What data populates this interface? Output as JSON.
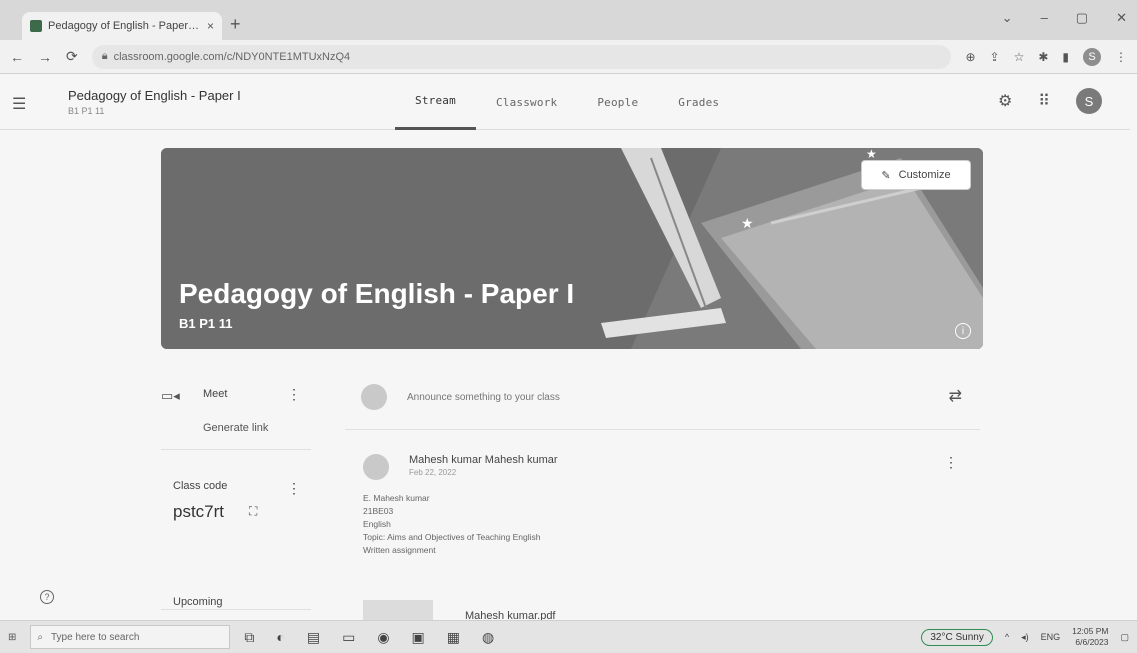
{
  "browser": {
    "tab_title": "Pedagogy of English - Paper I | Cl",
    "tab_close": "×",
    "new_tab": "+",
    "url": "classroom.google.com/c/NDY0NTE1MTUxNzQ4",
    "window_controls": [
      "⌄",
      "–",
      "▢",
      "✕"
    ],
    "profile_initial": "S"
  },
  "classroom_header": {
    "course_name": "Pedagogy of English - Paper I",
    "section": "B1 P1 11",
    "tabs": [
      {
        "label": "Stream"
      },
      {
        "label": "Classwork"
      },
      {
        "label": "People"
      },
      {
        "label": "Grades"
      }
    ],
    "avatar_initial": "S"
  },
  "banner": {
    "title": "Pedagogy of English - Paper I",
    "subtitle": "B1 P1 11",
    "customize_label": "Customize",
    "info_glyph": "i"
  },
  "meet": {
    "label": "Meet",
    "generate_link": "Generate link"
  },
  "class_code": {
    "label": "Class code",
    "value": "pstc7rt"
  },
  "upcoming": {
    "label": "Upcoming"
  },
  "announce": {
    "placeholder": "Announce something to your class"
  },
  "post": {
    "author": "Mahesh kumar Mahesh kumar",
    "date": "Feb 22, 2022",
    "lines": [
      "E. Mahesh kumar",
      "21BE03",
      "English",
      "Topic: Aims and Objectives of Teaching English",
      "Written assignment"
    ],
    "attachment_name": "Mahesh kumar.pdf"
  },
  "help_glyph": "?",
  "taskbar": {
    "search_placeholder": "Type here to search",
    "weather": "32°C  Sunny",
    "language": "ENG",
    "time": "12:05 PM",
    "date": "6/6/2023"
  },
  "icons": {
    "lock": "lock-icon",
    "hamburger": "menu-icon",
    "settings": "gear-icon",
    "apps": "apps-grid-icon",
    "meet": "video-camera-icon",
    "repost": "repost-icon",
    "pencil": "pencil-icon"
  },
  "colors": {
    "banner": "#6c6c6c",
    "weather_ring": "#2f8c52"
  }
}
